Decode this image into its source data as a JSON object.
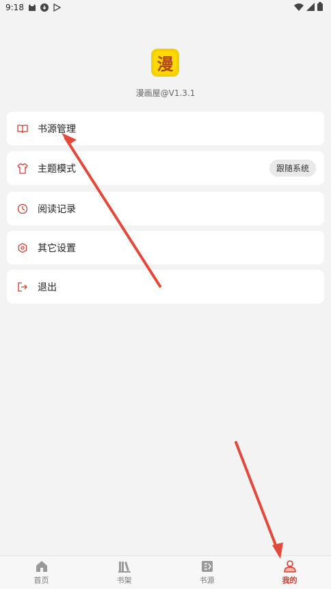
{
  "status_bar": {
    "time": "9:18"
  },
  "app": {
    "logo_char": "漫",
    "version": "漫画屋@V1.3.1"
  },
  "menu": {
    "items": [
      {
        "label": "书源管理"
      },
      {
        "label": "主题模式",
        "badge": "跟随系统"
      },
      {
        "label": "阅读记录"
      },
      {
        "label": "其它设置"
      },
      {
        "label": "退出"
      }
    ]
  },
  "bottom_nav": {
    "items": [
      {
        "label": "首页"
      },
      {
        "label": "书架"
      },
      {
        "label": "书源"
      },
      {
        "label": "我的"
      }
    ]
  },
  "colors": {
    "accent": "#d83a2e",
    "logo_bg": "#ffd900",
    "annotation_arrow": "#e4483a"
  }
}
